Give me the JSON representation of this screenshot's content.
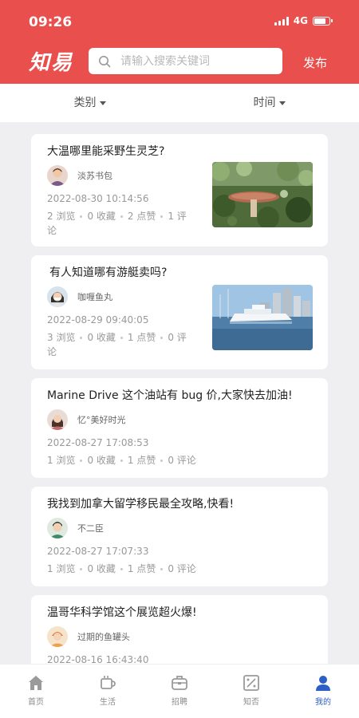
{
  "status": {
    "time": "09:26",
    "network": "4G"
  },
  "header": {
    "logo": "知易",
    "search_placeholder": "请输入搜索关键词",
    "publish": "发布"
  },
  "filters": [
    {
      "label": "类别"
    },
    {
      "label": "时间"
    }
  ],
  "posts": [
    {
      "title": "大温哪里能采野生灵芝?",
      "author": "淡苏书包",
      "date": "2022-08-30 10:14:56",
      "views": "2 浏览",
      "favorites": "0 收藏",
      "likes": "2 点赞",
      "comments_a": "1 评",
      "comments_b": "论",
      "image": "mushroom-in-forest"
    },
    {
      "title": "有人知道哪有游艇卖吗?",
      "author": "咖喱鱼丸",
      "date": "2022-08-29 09:40:05",
      "views": "3 浏览",
      "favorites": "0 收藏",
      "likes": "1 点赞",
      "comments_a": "0 评",
      "comments_b": "论",
      "image": "yachts-at-harbor"
    },
    {
      "title": "Marine Drive 这个油站有 bug 价,大家快去加油!",
      "author": "忆°美好时光",
      "date": "2022-08-27 17:08:53",
      "views": "1 浏览",
      "favorites": "0 收藏",
      "likes": "1 点赞",
      "comments": "0 评论"
    },
    {
      "title": "我找到加拿大留学移民最全攻略,快看!",
      "author": "不二臣",
      "date": "2022-08-27 17:07:33",
      "views": "1 浏览",
      "favorites": "0 收藏",
      "likes": "1 点赞",
      "comments": "0 评论"
    },
    {
      "title": "温哥华科学馆这个展览超火爆!",
      "author": "过期的鱼罐头",
      "date": "2022-08-16 16:43:40"
    }
  ],
  "tabs": [
    {
      "label": "首页",
      "icon": "home-icon"
    },
    {
      "label": "生活",
      "icon": "cup-icon"
    },
    {
      "label": "招聘",
      "icon": "briefcase-icon"
    },
    {
      "label": "知否",
      "icon": "quiz-icon"
    },
    {
      "label": "我的",
      "icon": "user-icon",
      "active": true
    }
  ],
  "colors": {
    "brand": "#e9504d",
    "active_tab": "#2d5fc4"
  }
}
